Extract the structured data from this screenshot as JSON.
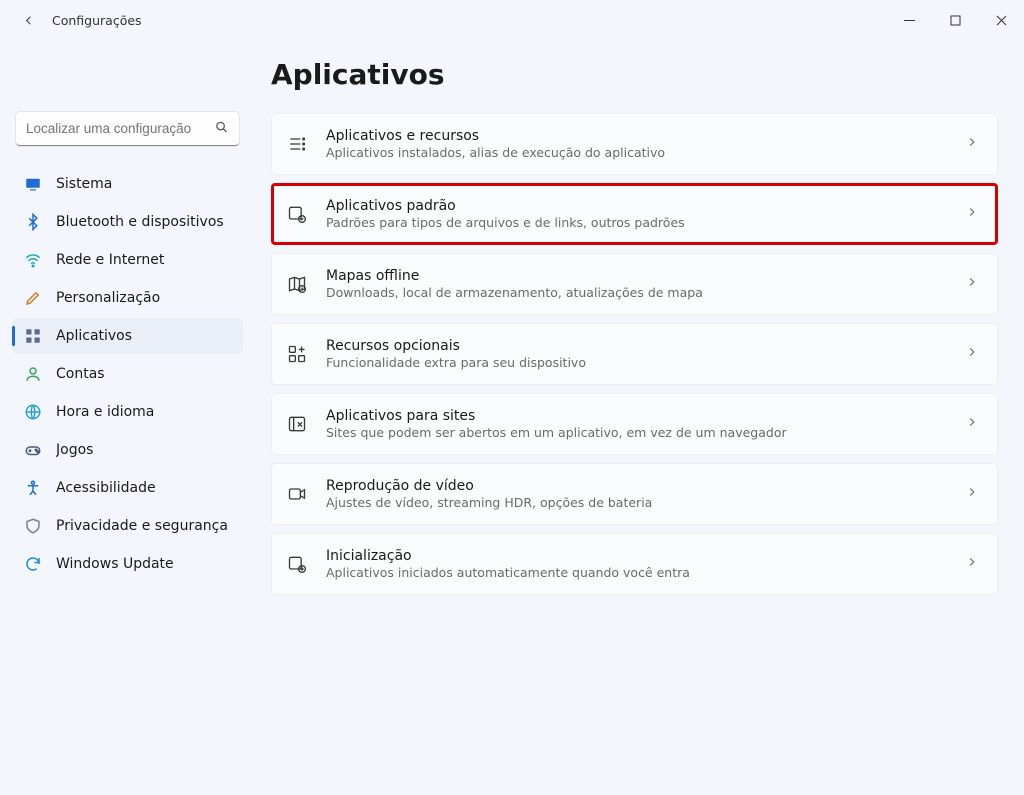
{
  "window": {
    "title": "Configurações"
  },
  "search": {
    "placeholder": "Localizar uma configuração"
  },
  "sidebar": {
    "items": [
      {
        "label": "Sistema",
        "icon": "system",
        "iconColor": "#1f6cd6"
      },
      {
        "label": "Bluetooth e dispositivos",
        "icon": "bluetooth",
        "iconColor": "#1f6cd6"
      },
      {
        "label": "Rede e Internet",
        "icon": "network",
        "iconColor": "#18a7c9"
      },
      {
        "label": "Personalização",
        "icon": "personalize",
        "iconColor": "#d37b24"
      },
      {
        "label": "Aplicativos",
        "icon": "apps",
        "iconColor": "#5b6b8f",
        "active": true
      },
      {
        "label": "Contas",
        "icon": "accounts",
        "iconColor": "#3aa655"
      },
      {
        "label": "Hora e idioma",
        "icon": "time",
        "iconColor": "#2a9fcf"
      },
      {
        "label": "Jogos",
        "icon": "games",
        "iconColor": "#4a5a7a"
      },
      {
        "label": "Acessibilidade",
        "icon": "accessibility",
        "iconColor": "#1f6cd6"
      },
      {
        "label": "Privacidade e segurança",
        "icon": "privacy",
        "iconColor": "#7a8088"
      },
      {
        "label": "Windows Update",
        "icon": "update",
        "iconColor": "#1f8ad6"
      }
    ]
  },
  "page": {
    "title": "Aplicativos",
    "cards": [
      {
        "title": "Aplicativos e recursos",
        "sub": "Aplicativos instalados, alias de execução do aplicativo",
        "icon": "apps-features"
      },
      {
        "title": "Aplicativos padrão",
        "sub": "Padrões para tipos de arquivos e de links, outros padrões",
        "icon": "default-apps",
        "highlight": true
      },
      {
        "title": "Mapas offline",
        "sub": "Downloads, local de armazenamento, atualizações de mapa",
        "icon": "offline-maps"
      },
      {
        "title": "Recursos opcionais",
        "sub": "Funcionalidade extra para seu dispositivo",
        "icon": "optional-features"
      },
      {
        "title": "Aplicativos para sites",
        "sub": "Sites que podem ser abertos em um aplicativo, em vez de um navegador",
        "icon": "apps-for-sites"
      },
      {
        "title": "Reprodução de vídeo",
        "sub": "Ajustes de vídeo, streaming HDR, opções de bateria",
        "icon": "video-playback"
      },
      {
        "title": "Inicialização",
        "sub": "Aplicativos iniciados automaticamente quando você entra",
        "icon": "startup"
      }
    ]
  }
}
